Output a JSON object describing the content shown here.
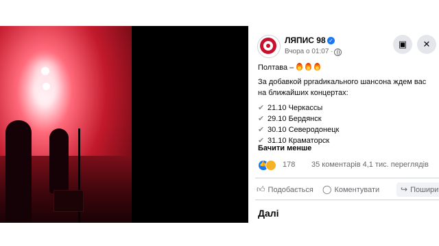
{
  "post": {
    "page_name": "ЛЯПИС 98",
    "time": "Вчора о 01:07 ·",
    "title": "Полтава –",
    "body": "За добавкой ррradикального шансона ждем вас на ближайших концертах:",
    "concerts": [
      {
        "check": "✔",
        "text": "21.10 Черкассы"
      },
      {
        "check": "✔",
        "text": "29.10 Бердянск"
      },
      {
        "check": "✔",
        "text": "30.10 Северодонецк"
      },
      {
        "check": "✔",
        "text": "31.10 Краматорск"
      }
    ],
    "see_less": "Бачити менше",
    "reaction_count": "178",
    "stats": "35 коментарів  4,1 тис. переглядів"
  },
  "actions": {
    "like": "Подобається",
    "comment": "Коментувати",
    "share": "Поширити"
  },
  "next_label": "Далі",
  "icons": {
    "save": "save-icon",
    "close": "close-icon",
    "globe": "globe-icon",
    "verified": "verified-badge-icon"
  },
  "colors": {
    "brand_blue": "#1877f2",
    "logo_red": "#c8102e",
    "muted": "#65676b"
  }
}
